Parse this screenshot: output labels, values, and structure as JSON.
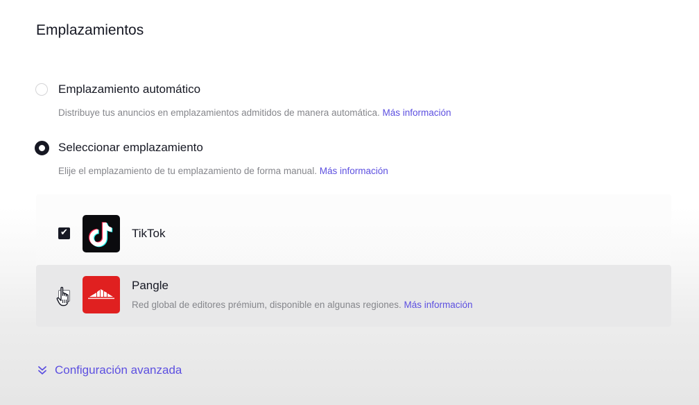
{
  "section": {
    "title": "Emplazamientos"
  },
  "placement_mode": {
    "selected": "manual",
    "automatic": {
      "label": "Emplazamiento automático",
      "description": "Distribuye tus anuncios en emplazamientos admitidos de manera automática.",
      "link": "Más información"
    },
    "manual": {
      "label": "Seleccionar emplazamiento",
      "description": "Elije el emplazamiento de tu emplazamiento de forma manual.",
      "link": "Más información"
    }
  },
  "placements": [
    {
      "name": "TikTok",
      "checked": true,
      "icon": "tiktok-logo-icon"
    },
    {
      "name": "Pangle",
      "checked": false,
      "icon": "pangle-logo-icon",
      "description": "Red global de editores prémium, disponible en algunas regiones.",
      "link": "Más información"
    }
  ],
  "advanced": {
    "label": "Configuración avanzada",
    "icon": "double-chevron-down-icon"
  },
  "colors": {
    "accent_link": "#5c4fe0",
    "text_primary": "#161823",
    "text_secondary": "#85868b",
    "tiktok_bg": "#0b0b0e",
    "pangle_bg": "#e02020",
    "row_hover_bg": "#e8e8e9"
  }
}
